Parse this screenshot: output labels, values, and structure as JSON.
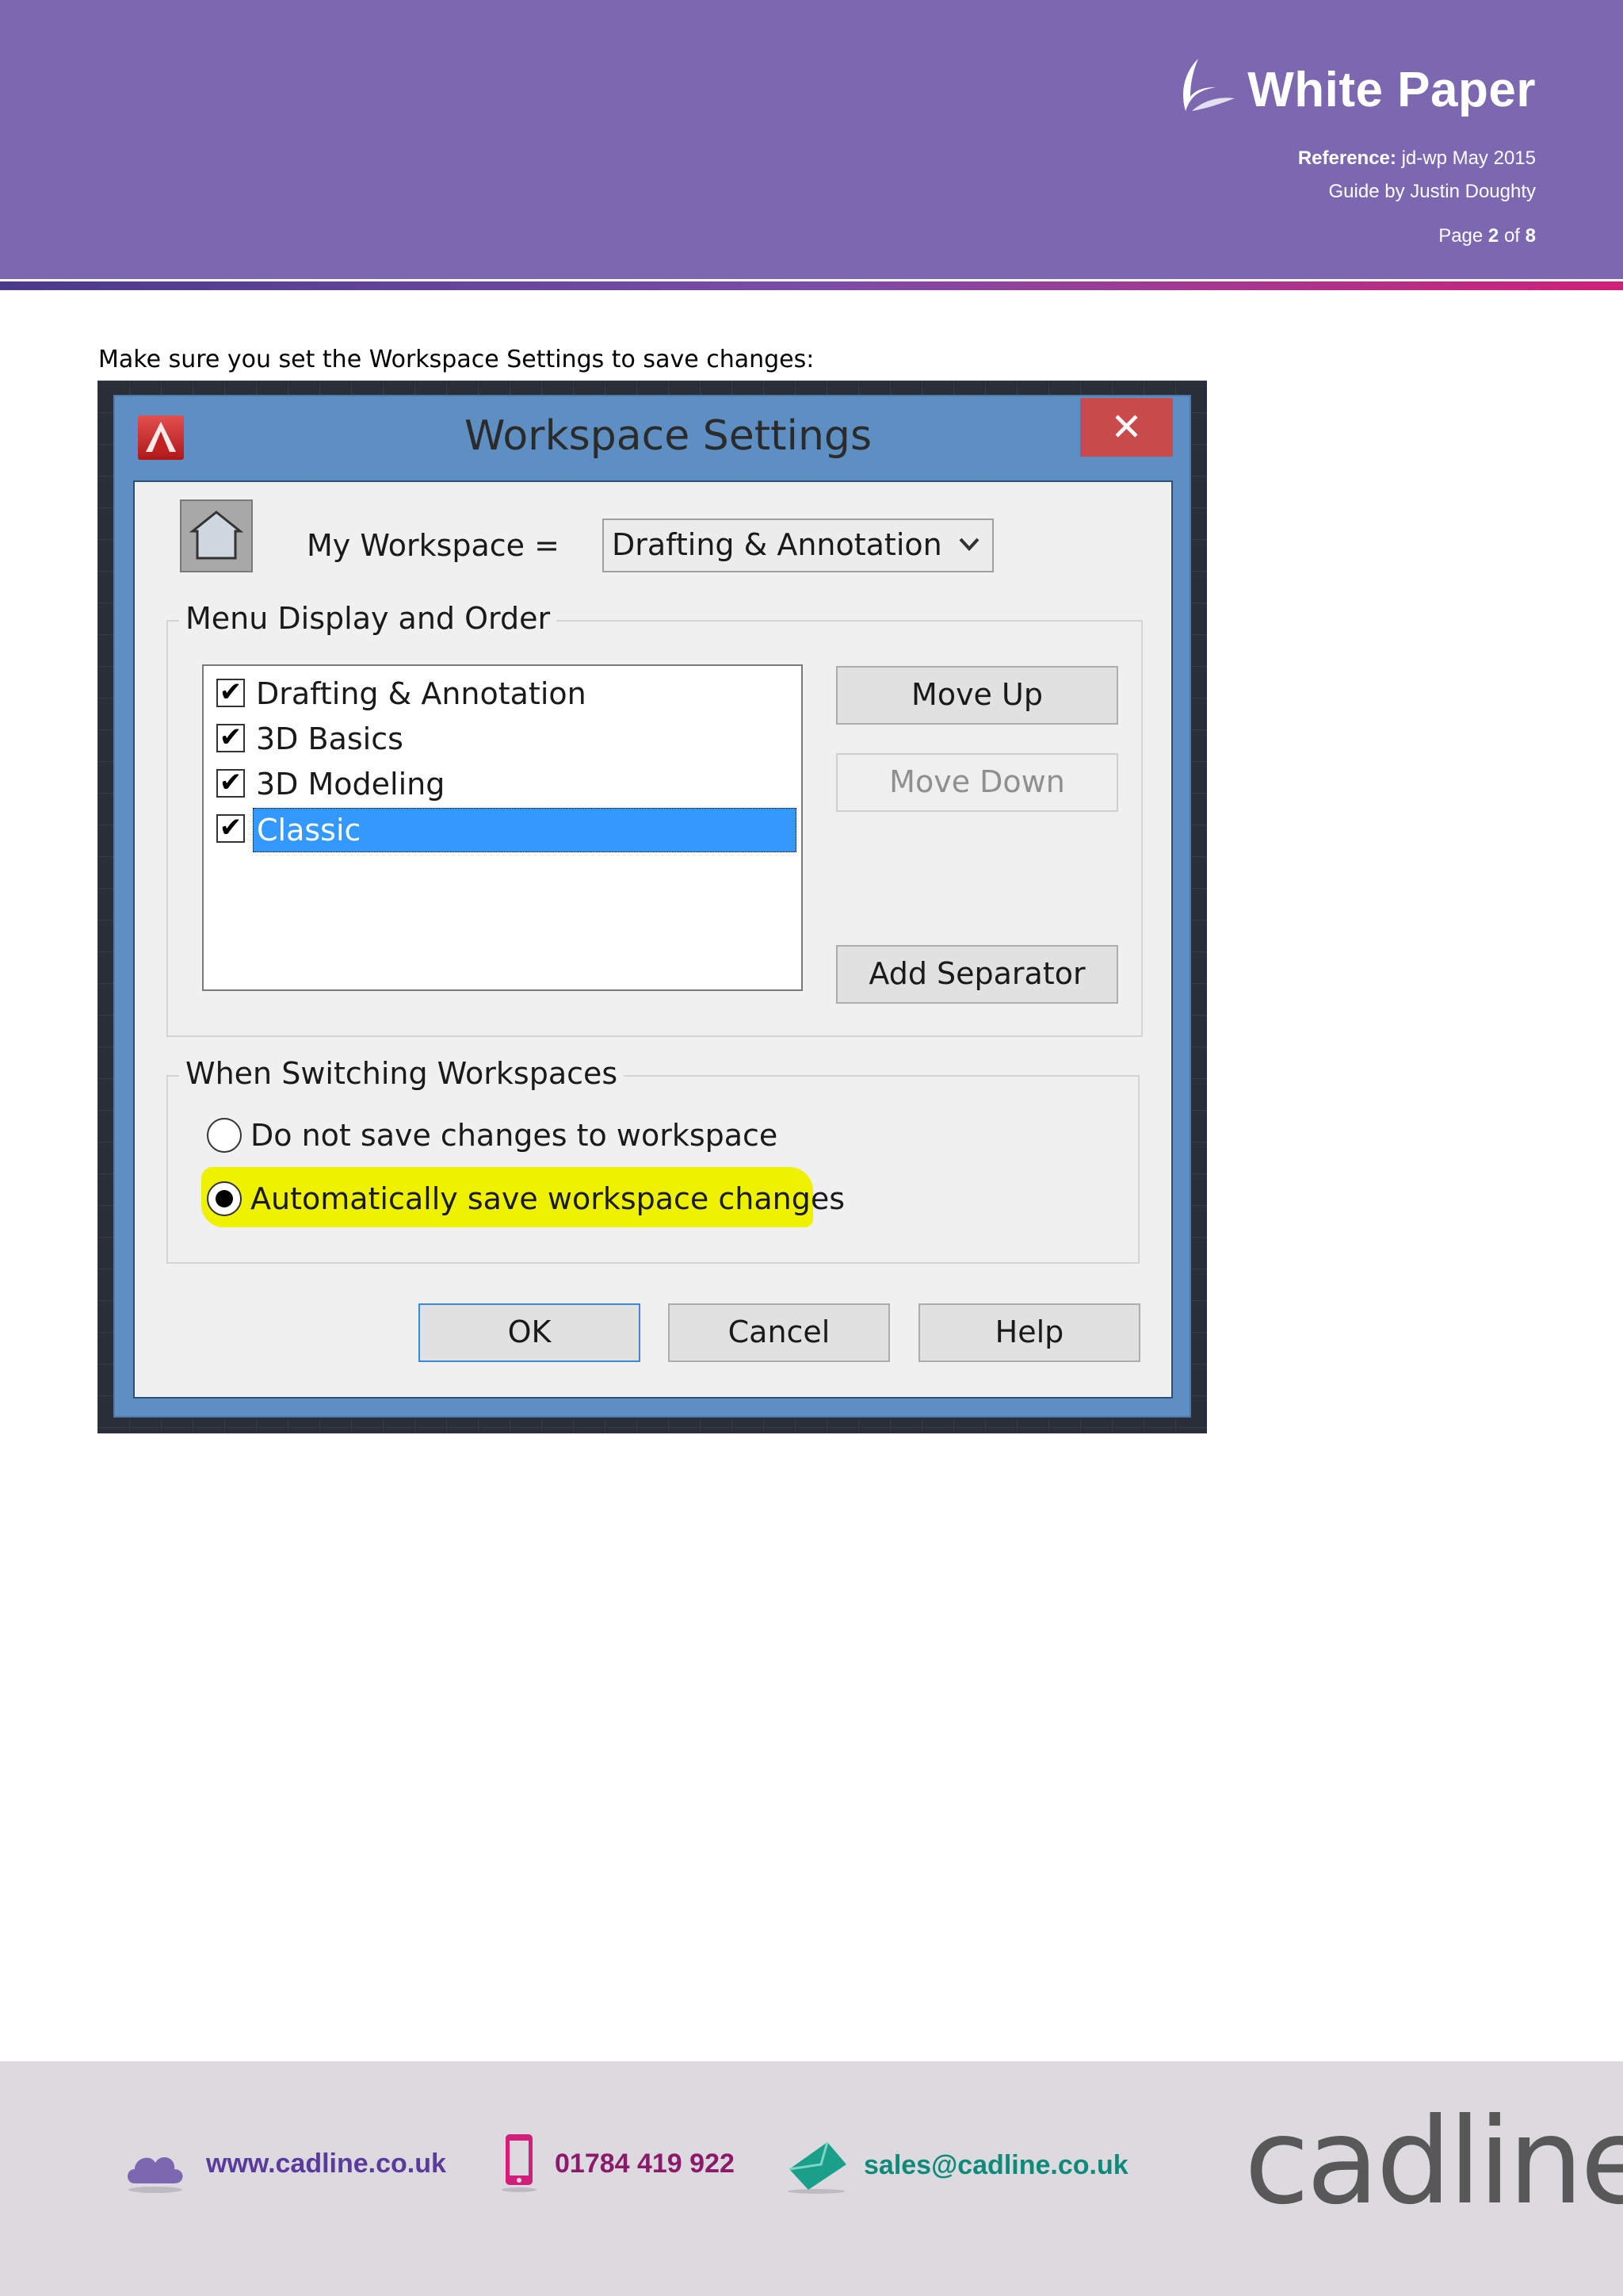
{
  "header": {
    "title": "White Paper",
    "reference_label": "Reference:",
    "reference_value": " jd-wp May 2015",
    "guide": "Guide by Justin Doughty",
    "page_prefix": "Page ",
    "page_current": "2",
    "page_of": " of ",
    "page_total": "8"
  },
  "body": {
    "intro": "Make sure you set the Workspace Settings to save changes:"
  },
  "dialog": {
    "title": "Workspace Settings",
    "close": "✕",
    "my_workspace_label": "My Workspace =",
    "my_workspace_value": "Drafting & Annotation",
    "menu_group_label": "Menu Display and Order",
    "list_items": [
      {
        "label": "Drafting & Annotation",
        "checked": true
      },
      {
        "label": "3D Basics",
        "checked": true
      },
      {
        "label": "3D Modeling",
        "checked": true
      },
      {
        "label": "Classic",
        "checked": true,
        "selected": true
      }
    ],
    "move_up": "Move Up",
    "move_down": "Move Down",
    "add_separator": "Add Separator",
    "switch_group_label": "When Switching Workspaces",
    "radio_no_save": "Do not save changes to workspace",
    "radio_auto_save": "Automatically save workspace changes",
    "ok": "OK",
    "cancel": "Cancel",
    "help": "Help"
  },
  "footer": {
    "website": "www.cadline.co.uk",
    "phone": "01784 419 922",
    "email": "sales@cadline.co.uk",
    "brand": "cadline",
    "colors": {
      "website": "#5a3a9a",
      "phone": "#8b1a6a",
      "email": "#0f8a7a"
    }
  }
}
